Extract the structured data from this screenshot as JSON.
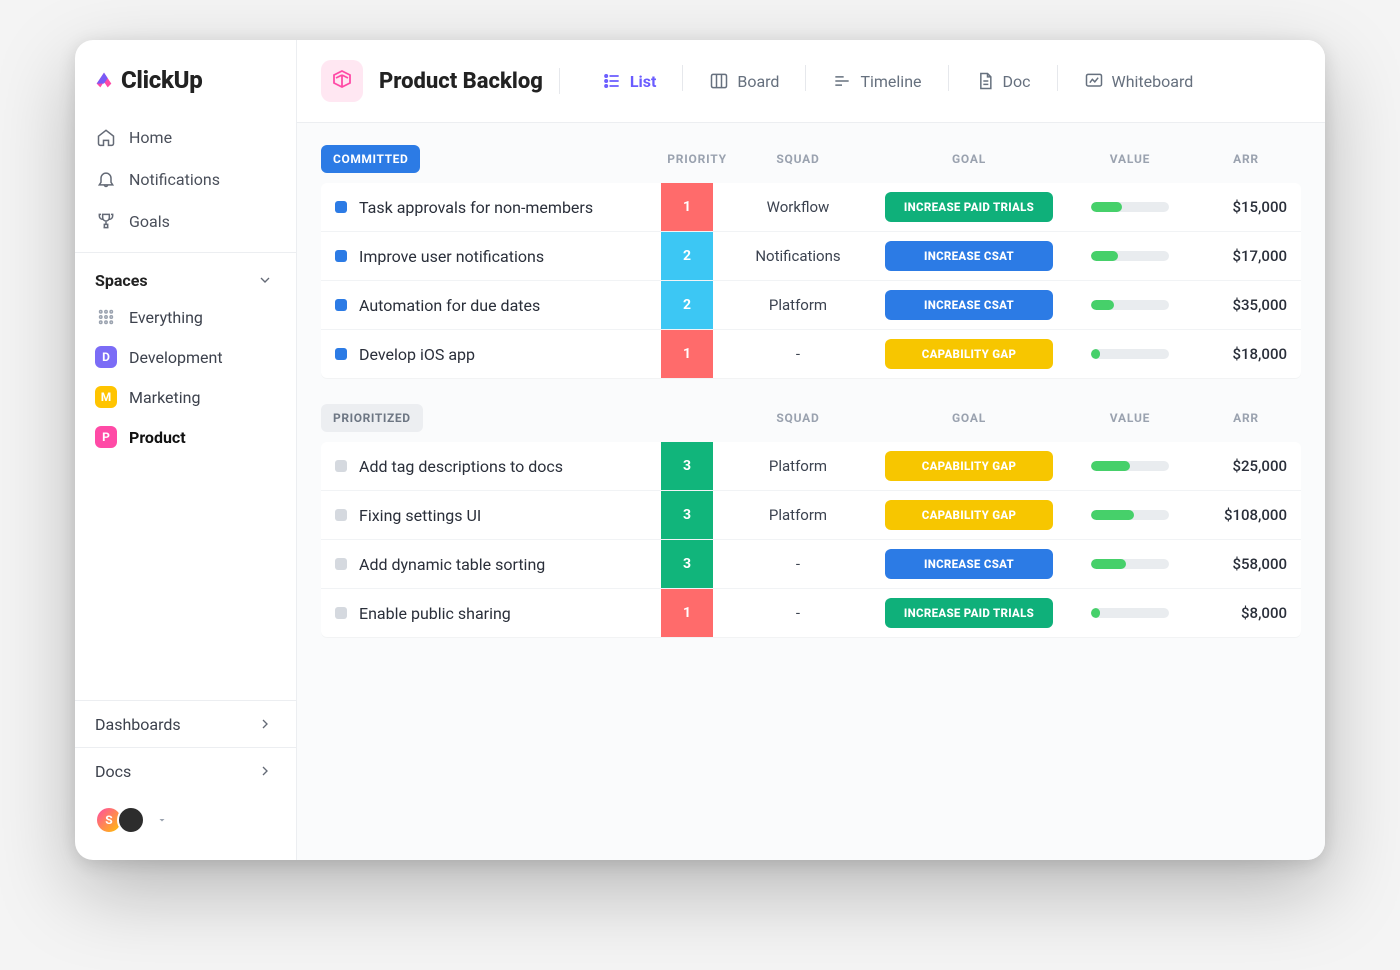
{
  "brand": "ClickUp",
  "sidebar": {
    "nav": [
      {
        "label": "Home",
        "icon": "home-icon"
      },
      {
        "label": "Notifications",
        "icon": "bell-icon"
      },
      {
        "label": "Goals",
        "icon": "trophy-icon"
      }
    ],
    "spaces_label": "Spaces",
    "everything_label": "Everything",
    "spaces": [
      {
        "letter": "D",
        "label": "Development",
        "color": "#7b6cf6"
      },
      {
        "letter": "M",
        "label": "Marketing",
        "color": "#ffc400"
      },
      {
        "letter": "P",
        "label": "Product",
        "color": "#ff4aa6",
        "active": true
      }
    ],
    "links": [
      {
        "label": "Dashboards"
      },
      {
        "label": "Docs"
      }
    ],
    "avatars": [
      {
        "label": "S"
      },
      {
        "label": ""
      }
    ]
  },
  "header": {
    "title": "Product Backlog",
    "tabs": [
      {
        "label": "List",
        "active": true,
        "icon": "list-icon"
      },
      {
        "label": "Board",
        "icon": "board-icon"
      },
      {
        "label": "Timeline",
        "icon": "timeline-icon"
      },
      {
        "label": "Doc",
        "icon": "doc-icon"
      },
      {
        "label": "Whiteboard",
        "icon": "whiteboard-icon"
      }
    ]
  },
  "columns": {
    "priority": "PRIORITY",
    "squad": "SQUAD",
    "goal": "GOAL",
    "value": "VALUE",
    "arr": "ARR"
  },
  "groups": [
    {
      "name": "COMMITTED",
      "style": "committed",
      "show_priority_header": true,
      "rows": [
        {
          "status": "blue",
          "title": "Task approvals for non-members",
          "priority": 1,
          "prio_class": "prio-1",
          "squad": "Workflow",
          "goal": "INCREASE PAID TRIALS",
          "goal_class": "goal-green",
          "value_pct": 40,
          "arr": "$15,000"
        },
        {
          "status": "blue",
          "title": "Improve  user notifications",
          "priority": 2,
          "prio_class": "prio-2",
          "squad": "Notifications",
          "goal": "INCREASE CSAT",
          "goal_class": "goal-blue",
          "value_pct": 35,
          "arr": "$17,000"
        },
        {
          "status": "blue",
          "title": "Automation for due dates",
          "priority": 2,
          "prio_class": "prio-2",
          "squad": "Platform",
          "goal": "INCREASE CSAT",
          "goal_class": "goal-blue",
          "value_pct": 30,
          "arr": "$35,000"
        },
        {
          "status": "blue",
          "title": "Develop iOS app",
          "priority": 1,
          "prio_class": "prio-1",
          "squad": "-",
          "goal": "CAPABILITY GAP",
          "goal_class": "goal-yellow",
          "value_pct": 12,
          "arr": "$18,000"
        }
      ]
    },
    {
      "name": "PRIORITIZED",
      "style": "prioritized",
      "show_priority_header": false,
      "rows": [
        {
          "status": "grey",
          "title": "Add tag descriptions to docs",
          "priority": 3,
          "prio_class": "prio-3",
          "squad": "Platform",
          "goal": "CAPABILITY GAP",
          "goal_class": "goal-yellow",
          "value_pct": 50,
          "arr": "$25,000"
        },
        {
          "status": "grey",
          "title": "Fixing settings UI",
          "priority": 3,
          "prio_class": "prio-3",
          "squad": "Platform",
          "goal": "CAPABILITY GAP",
          "goal_class": "goal-yellow",
          "value_pct": 55,
          "arr": "$108,000"
        },
        {
          "status": "grey",
          "title": "Add dynamic table sorting",
          "priority": 3,
          "prio_class": "prio-3",
          "squad": "-",
          "goal": "INCREASE CSAT",
          "goal_class": "goal-blue",
          "value_pct": 45,
          "arr": "$58,000"
        },
        {
          "status": "grey",
          "title": "Enable public sharing",
          "priority": 1,
          "prio_class": "prio-1",
          "squad": "-",
          "goal": "INCREASE PAID TRIALS",
          "goal_class": "goal-green",
          "value_pct": 12,
          "arr": "$8,000"
        }
      ]
    }
  ]
}
